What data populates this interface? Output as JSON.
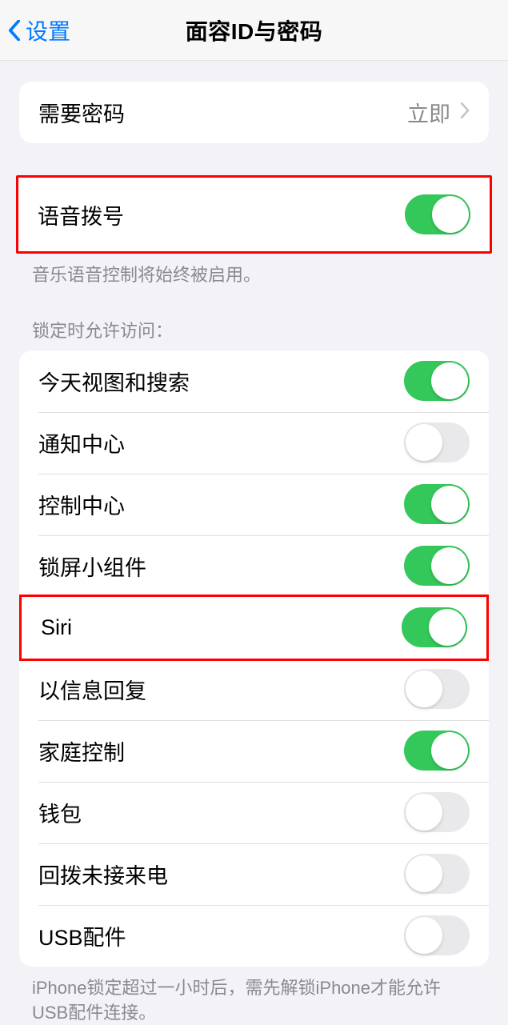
{
  "nav": {
    "back_label": "设置",
    "title": "面容ID与密码"
  },
  "passcode": {
    "label": "需要密码",
    "value": "立即"
  },
  "voice_dial": {
    "label": "语音拨号",
    "on": true,
    "footer": "音乐语音控制将始终被启用。"
  },
  "lock_access": {
    "header": "锁定时允许访问：",
    "items": [
      {
        "label": "今天视图和搜索",
        "on": true,
        "highlighted": false
      },
      {
        "label": "通知中心",
        "on": false,
        "highlighted": false
      },
      {
        "label": "控制中心",
        "on": true,
        "highlighted": false
      },
      {
        "label": "锁屏小组件",
        "on": true,
        "highlighted": false
      },
      {
        "label": "Siri",
        "on": true,
        "highlighted": true
      },
      {
        "label": "以信息回复",
        "on": false,
        "highlighted": false
      },
      {
        "label": "家庭控制",
        "on": true,
        "highlighted": false
      },
      {
        "label": "钱包",
        "on": false,
        "highlighted": false
      },
      {
        "label": "回拨未接来电",
        "on": false,
        "highlighted": false
      },
      {
        "label": "USB配件",
        "on": false,
        "highlighted": false
      }
    ],
    "footer": "iPhone锁定超过一小时后，需先解锁iPhone才能允许USB配件连接。"
  }
}
